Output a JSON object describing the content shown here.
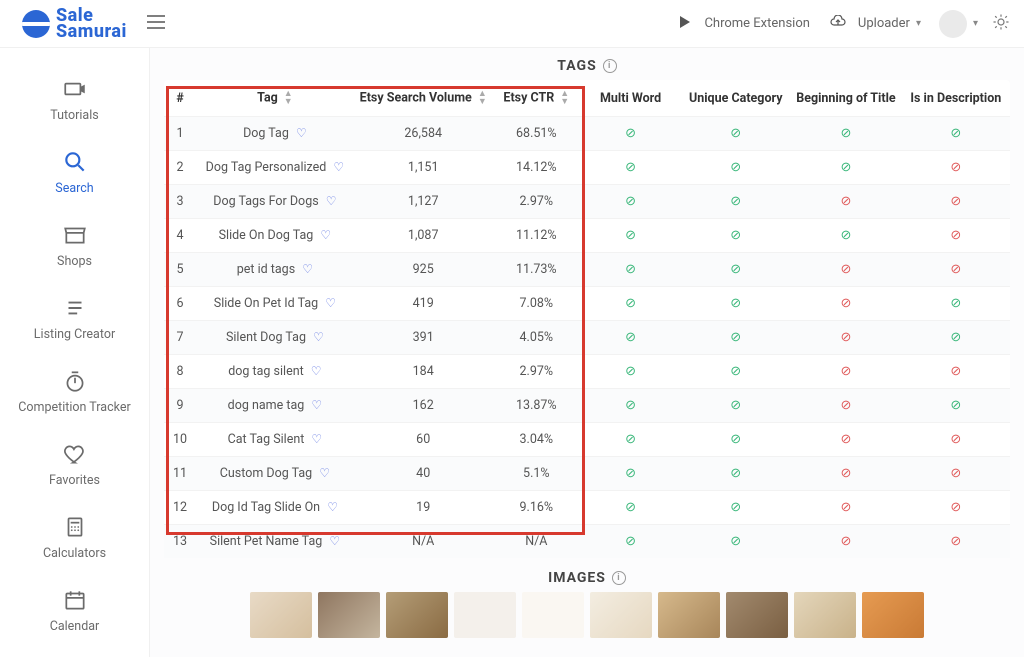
{
  "brand": {
    "line1": "Sale",
    "line2": "Samurai"
  },
  "topbar": {
    "chrome_ext": "Chrome Extension",
    "uploader": "Uploader"
  },
  "sidebar": {
    "items": [
      {
        "label": "Tutorials"
      },
      {
        "label": "Search"
      },
      {
        "label": "Shops"
      },
      {
        "label": "Listing Creator"
      },
      {
        "label": "Competition Tracker"
      },
      {
        "label": "Favorites"
      },
      {
        "label": "Calculators"
      },
      {
        "label": "Calendar"
      }
    ]
  },
  "tags_section": {
    "title": "TAGS",
    "images_title": "IMAGES",
    "headers": {
      "num": "#",
      "tag": "Tag",
      "vol": "Etsy Search Volume",
      "ctr": "Etsy CTR",
      "multi": "Multi Word",
      "unique": "Unique Category",
      "begin": "Beginning of Title",
      "desc": "Is in Description"
    },
    "rows": [
      {
        "n": "1",
        "tag": "Dog Tag",
        "vol": "26,584",
        "ctr": "68.51%",
        "multi": true,
        "unique": true,
        "begin": true,
        "desc": true
      },
      {
        "n": "2",
        "tag": "Dog Tag Personalized",
        "vol": "1,151",
        "ctr": "14.12%",
        "multi": true,
        "unique": true,
        "begin": true,
        "desc": false
      },
      {
        "n": "3",
        "tag": "Dog Tags For Dogs",
        "vol": "1,127",
        "ctr": "2.97%",
        "multi": true,
        "unique": true,
        "begin": false,
        "desc": false
      },
      {
        "n": "4",
        "tag": "Slide On Dog Tag",
        "vol": "1,087",
        "ctr": "11.12%",
        "multi": true,
        "unique": true,
        "begin": true,
        "desc": false
      },
      {
        "n": "5",
        "tag": "pet id tags",
        "vol": "925",
        "ctr": "11.73%",
        "multi": true,
        "unique": true,
        "begin": false,
        "desc": false
      },
      {
        "n": "6",
        "tag": "Slide On Pet Id Tag",
        "vol": "419",
        "ctr": "7.08%",
        "multi": true,
        "unique": true,
        "begin": false,
        "desc": true
      },
      {
        "n": "7",
        "tag": "Silent Dog Tag",
        "vol": "391",
        "ctr": "4.05%",
        "multi": true,
        "unique": true,
        "begin": false,
        "desc": true
      },
      {
        "n": "8",
        "tag": "dog tag silent",
        "vol": "184",
        "ctr": "2.97%",
        "multi": true,
        "unique": true,
        "begin": false,
        "desc": false
      },
      {
        "n": "9",
        "tag": "dog name tag",
        "vol": "162",
        "ctr": "13.87%",
        "multi": true,
        "unique": true,
        "begin": false,
        "desc": true
      },
      {
        "n": "10",
        "tag": "Cat Tag Silent",
        "vol": "60",
        "ctr": "3.04%",
        "multi": true,
        "unique": true,
        "begin": false,
        "desc": false
      },
      {
        "n": "11",
        "tag": "Custom Dog Tag",
        "vol": "40",
        "ctr": "5.1%",
        "multi": true,
        "unique": true,
        "begin": false,
        "desc": false
      },
      {
        "n": "12",
        "tag": "Dog Id Tag Slide On",
        "vol": "19",
        "ctr": "9.16%",
        "multi": true,
        "unique": true,
        "begin": false,
        "desc": false
      },
      {
        "n": "13",
        "tag": "Silent Pet Name Tag",
        "vol": "N/A",
        "ctr": "N/A",
        "multi": true,
        "unique": true,
        "begin": false,
        "desc": false
      }
    ]
  }
}
